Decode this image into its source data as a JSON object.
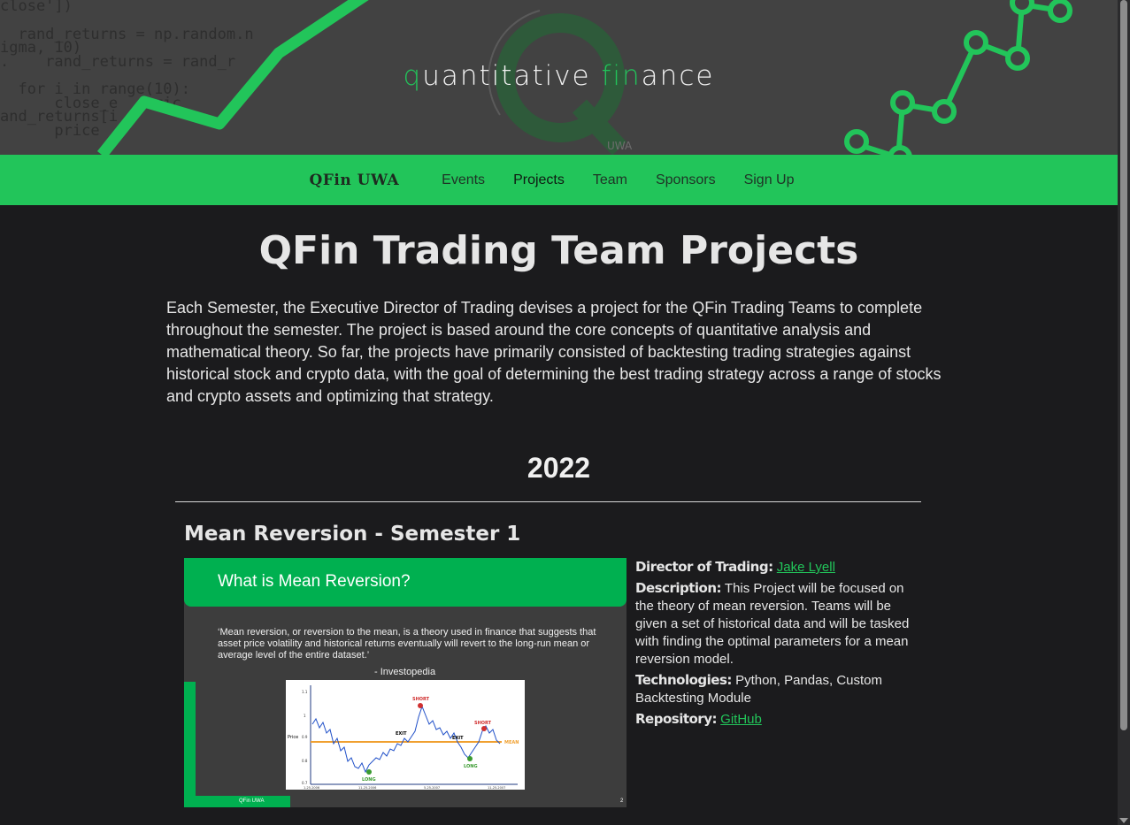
{
  "banner": {
    "code_lines": [
      "close'])",
      "  rand_returns = np.random.n",
      "igma, 10)",
      ".    rand_returns = rand_r",
      "  for i in range(10):",
      "      close_e    ric",
      "and_returns[i",
      "      price"
    ],
    "logo_part1_green": "q",
    "logo_part1": "uantitative ",
    "logo_part2_green": "fin",
    "logo_part2": "ance",
    "logo_sub": "UWA",
    "accent": "#22c55a"
  },
  "nav": {
    "brand": "QFin UWA",
    "items": [
      {
        "label": "Events"
      },
      {
        "label": "Projects"
      },
      {
        "label": "Team"
      },
      {
        "label": "Sponsors"
      },
      {
        "label": "Sign Up"
      }
    ],
    "active": "Projects"
  },
  "main": {
    "title": "QFin Trading Team Projects",
    "intro": "Each Semester, the Executive Director of Trading devises a project for the QFin Trading Teams to complete throughout the semester. The project is based around the core concepts of quantitative analysis and mathematical theory. So far, the projects have primarily consisted of backtesting trading strategies against historical stock and crypto data, with the goal of determining the best trading strategy across a range of stocks and crypto assets and optimizing that strategy.",
    "year": "2022",
    "project": {
      "title": "Mean Reversion - Semester 1",
      "slide": {
        "heading": "What is Mean Reversion?",
        "quote": "‘Mean reversion, or reversion to the mean, is a theory used in finance that suggests that asset price volatility and historical returns eventually will revert to the long-run mean or average level of the entire dataset.’",
        "attribution": "- Investopedia",
        "footer": "QFin UWA",
        "page": "2",
        "chart": {
          "ylabel": "Price",
          "y_ticks": [
            "1.1",
            "1",
            "0.9",
            "0.8",
            "0.7"
          ],
          "x_ticks": [
            "1-25-2006",
            "11-25-2006",
            "5-25-2007",
            "11-25-2007"
          ],
          "mean_label": "MEAN",
          "short_label": "SHORT",
          "long_label": "LONG",
          "exit_label": "EXIT"
        }
      },
      "director_label": "Director of Trading:",
      "director_name": "Jake Lyell",
      "description_label": "Description:",
      "description": "This Project will be focused on the theory of mean reversion. Teams will be given a set of historical data and will be tasked with finding the optimal parameters for a mean reversion model.",
      "technologies_label": "Technologies:",
      "technologies": "Python, Pandas, Custom Backtesting Module",
      "repository_label": "Repository:",
      "repository_link": "GitHub"
    }
  }
}
